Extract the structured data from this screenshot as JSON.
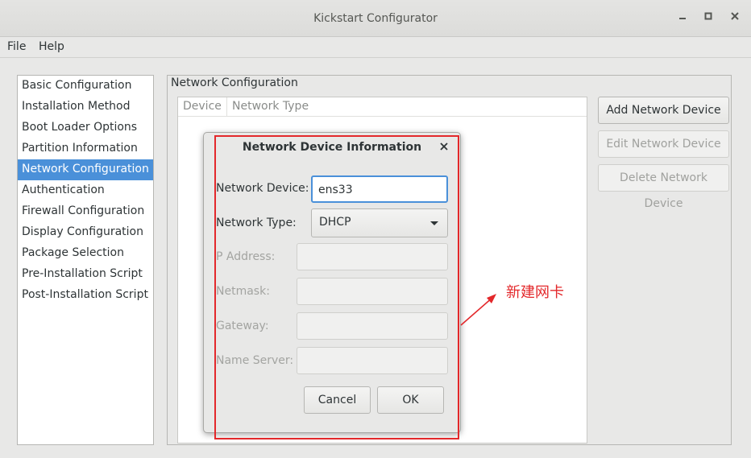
{
  "window": {
    "title": "Kickstart Configurator",
    "minimize_icon": "minimize-icon",
    "maximize_icon": "maximize-icon",
    "close_icon": "close-icon"
  },
  "menu": [
    "File",
    "Help"
  ],
  "sidebar": {
    "items": [
      {
        "label": "Basic Configuration"
      },
      {
        "label": "Installation Method"
      },
      {
        "label": "Boot Loader Options"
      },
      {
        "label": "Partition Information"
      },
      {
        "label": "Network Configuration",
        "selected": true
      },
      {
        "label": "Authentication"
      },
      {
        "label": "Firewall Configuration"
      },
      {
        "label": "Display Configuration"
      },
      {
        "label": "Package Selection"
      },
      {
        "label": "Pre-Installation Script"
      },
      {
        "label": "Post-Installation Script"
      }
    ]
  },
  "main": {
    "section_title": "Network Configuration",
    "columns": [
      "Device",
      "Network Type"
    ],
    "buttons": {
      "add": "Add Network Device",
      "edit": "Edit Network Device",
      "delete": "Delete Network Device"
    }
  },
  "dialog": {
    "title": "Network Device Information",
    "close_icon": "close-icon",
    "network_device_label": "Network Device:",
    "network_device_value": "ens33",
    "network_type_label": "Network Type:",
    "network_type_value": "DHCP",
    "ip_label": "P Address:",
    "netmask_label": "Netmask:",
    "gateway_label": "Gateway:",
    "nameserver_label": "Name Server:",
    "cancel": "Cancel",
    "ok": "OK"
  },
  "annotation": {
    "text": "新建网卡",
    "color": "#e3282b"
  },
  "colors": {
    "selection": "#4a90d9",
    "background": "#e8e8e7"
  }
}
